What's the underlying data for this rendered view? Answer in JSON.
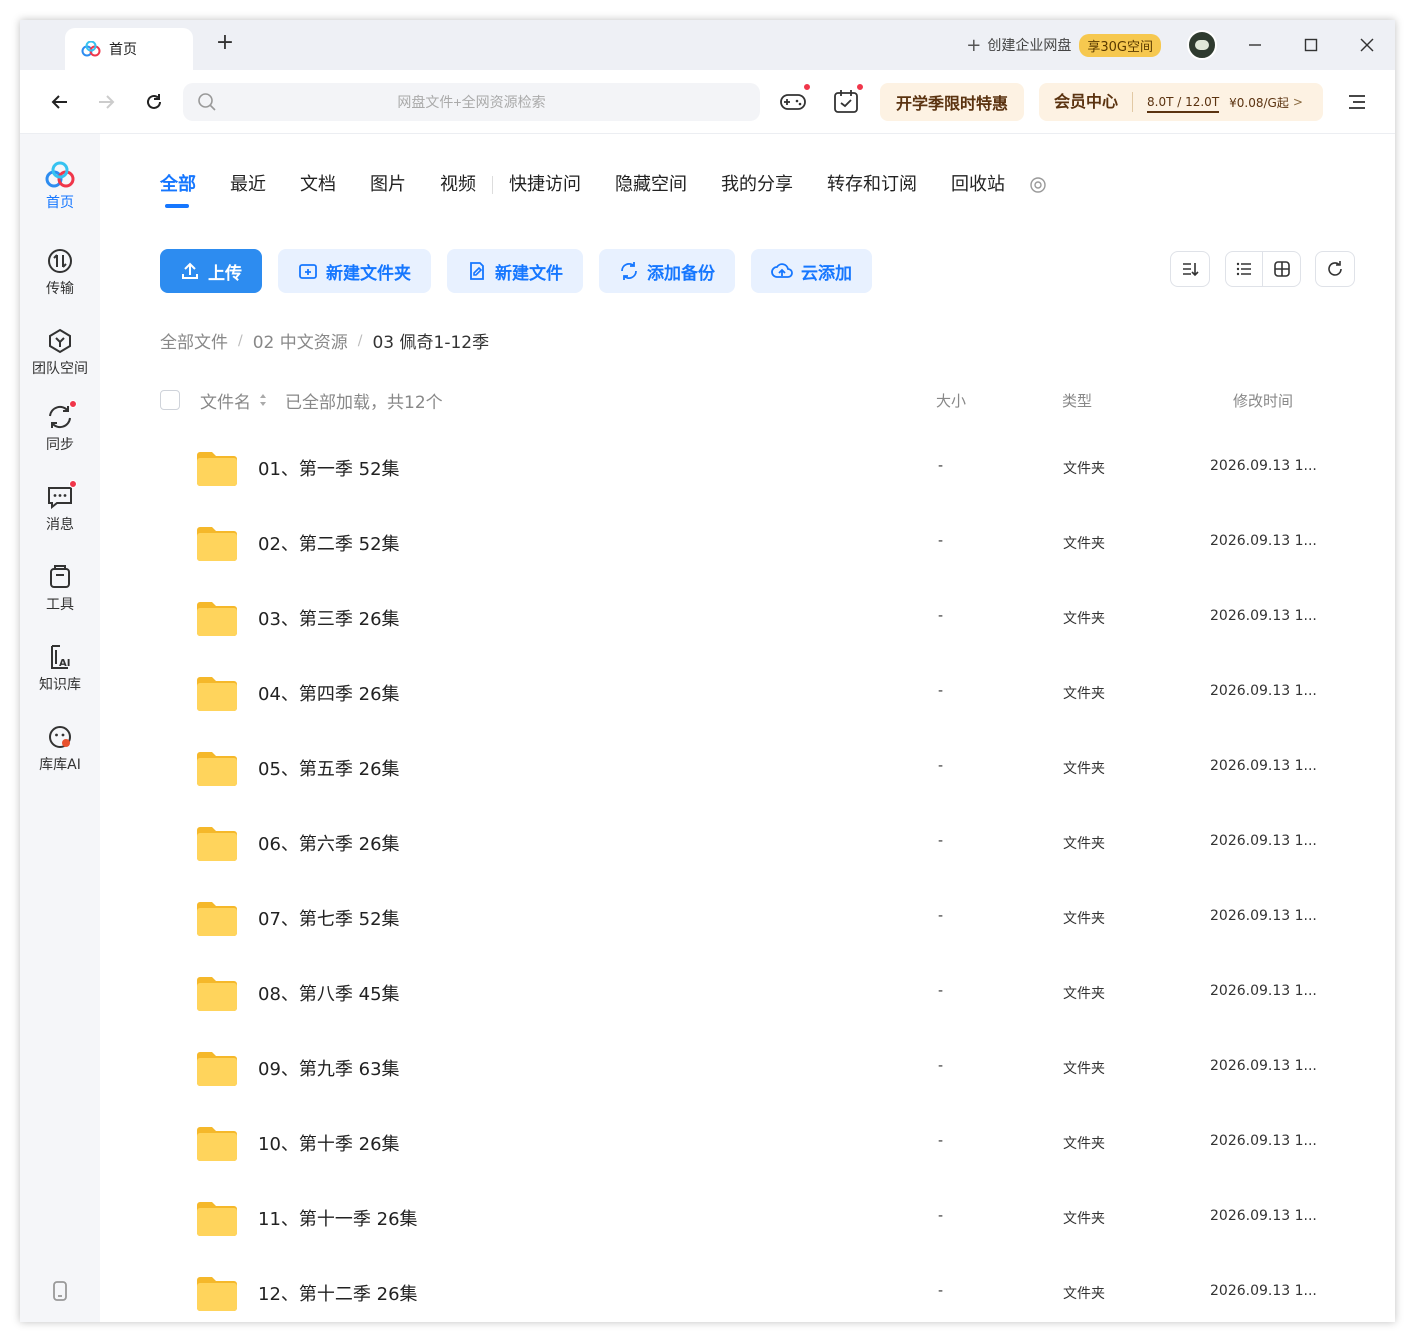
{
  "titlebar": {
    "tab_label": "首页",
    "tab_add": "+",
    "create_enterprise": "创建企业网盘",
    "bonus_badge": "享30G空间",
    "min": "—",
    "max": "☐",
    "close": "✕"
  },
  "toolbar": {
    "search_placeholder": "网盘文件+全网资源检索",
    "promo": "开学季限时特惠",
    "vip_label": "会员中心",
    "quota": "8.0T / 12.0T",
    "price": "¥0.08/G起",
    "price_arrow": ">"
  },
  "sidebar": {
    "items": [
      {
        "label": "首页",
        "icon": "baidu-logo-icon"
      },
      {
        "label": "传输",
        "icon": "transfer-icon"
      },
      {
        "label": "团队空间",
        "icon": "team-icon"
      },
      {
        "label": "同步",
        "icon": "sync-icon"
      },
      {
        "label": "消息",
        "icon": "message-icon"
      },
      {
        "label": "工具",
        "icon": "toolbox-icon"
      },
      {
        "label": "知识库",
        "icon": "knowledge-ai-icon"
      },
      {
        "label": "库库AI",
        "icon": "kuku-ai-icon"
      }
    ]
  },
  "tabs": [
    "全部",
    "最近",
    "文档",
    "图片",
    "视频",
    "快捷访问",
    "隐藏空间",
    "我的分享",
    "转存和订阅",
    "回收站"
  ],
  "actions": {
    "upload": "上传",
    "new_folder": "新建文件夹",
    "new_file": "新建文件",
    "add_backup": "添加备份",
    "cloud_add": "云添加"
  },
  "breadcrumb": [
    "全部文件",
    "02 中文资源",
    "03 佩奇1-12季"
  ],
  "table": {
    "col_name": "文件名",
    "loaded_info": "已全部加载，共12个",
    "col_size": "大小",
    "col_type": "类型",
    "col_mtime": "修改时间",
    "rows": [
      {
        "name": "01、第一季 52集",
        "size": "-",
        "type": "文件夹",
        "mtime": "2026.09.13 1..."
      },
      {
        "name": "02、第二季 52集",
        "size": "-",
        "type": "文件夹",
        "mtime": "2026.09.13 1..."
      },
      {
        "name": "03、第三季 26集",
        "size": "-",
        "type": "文件夹",
        "mtime": "2026.09.13 1..."
      },
      {
        "name": "04、第四季 26集",
        "size": "-",
        "type": "文件夹",
        "mtime": "2026.09.13 1..."
      },
      {
        "name": "05、第五季 26集",
        "size": "-",
        "type": "文件夹",
        "mtime": "2026.09.13 1..."
      },
      {
        "name": "06、第六季 26集",
        "size": "-",
        "type": "文件夹",
        "mtime": "2026.09.13 1..."
      },
      {
        "name": "07、第七季 52集",
        "size": "-",
        "type": "文件夹",
        "mtime": "2026.09.13 1..."
      },
      {
        "name": "08、第八季 45集",
        "size": "-",
        "type": "文件夹",
        "mtime": "2026.09.13 1..."
      },
      {
        "name": "09、第九季 63集",
        "size": "-",
        "type": "文件夹",
        "mtime": "2026.09.13 1..."
      },
      {
        "name": "10、第十季 26集",
        "size": "-",
        "type": "文件夹",
        "mtime": "2026.09.13 1..."
      },
      {
        "name": "11、第十一季 26集",
        "size": "-",
        "type": "文件夹",
        "mtime": "2026.09.13 1..."
      },
      {
        "name": "12、第十二季 26集",
        "size": "-",
        "type": "文件夹",
        "mtime": "2026.09.13 1..."
      }
    ]
  },
  "colors": {
    "accent": "#1677ff",
    "primary_button": "#2d8cf0",
    "folder": "#ffc83d",
    "notify": "#f0364a"
  }
}
